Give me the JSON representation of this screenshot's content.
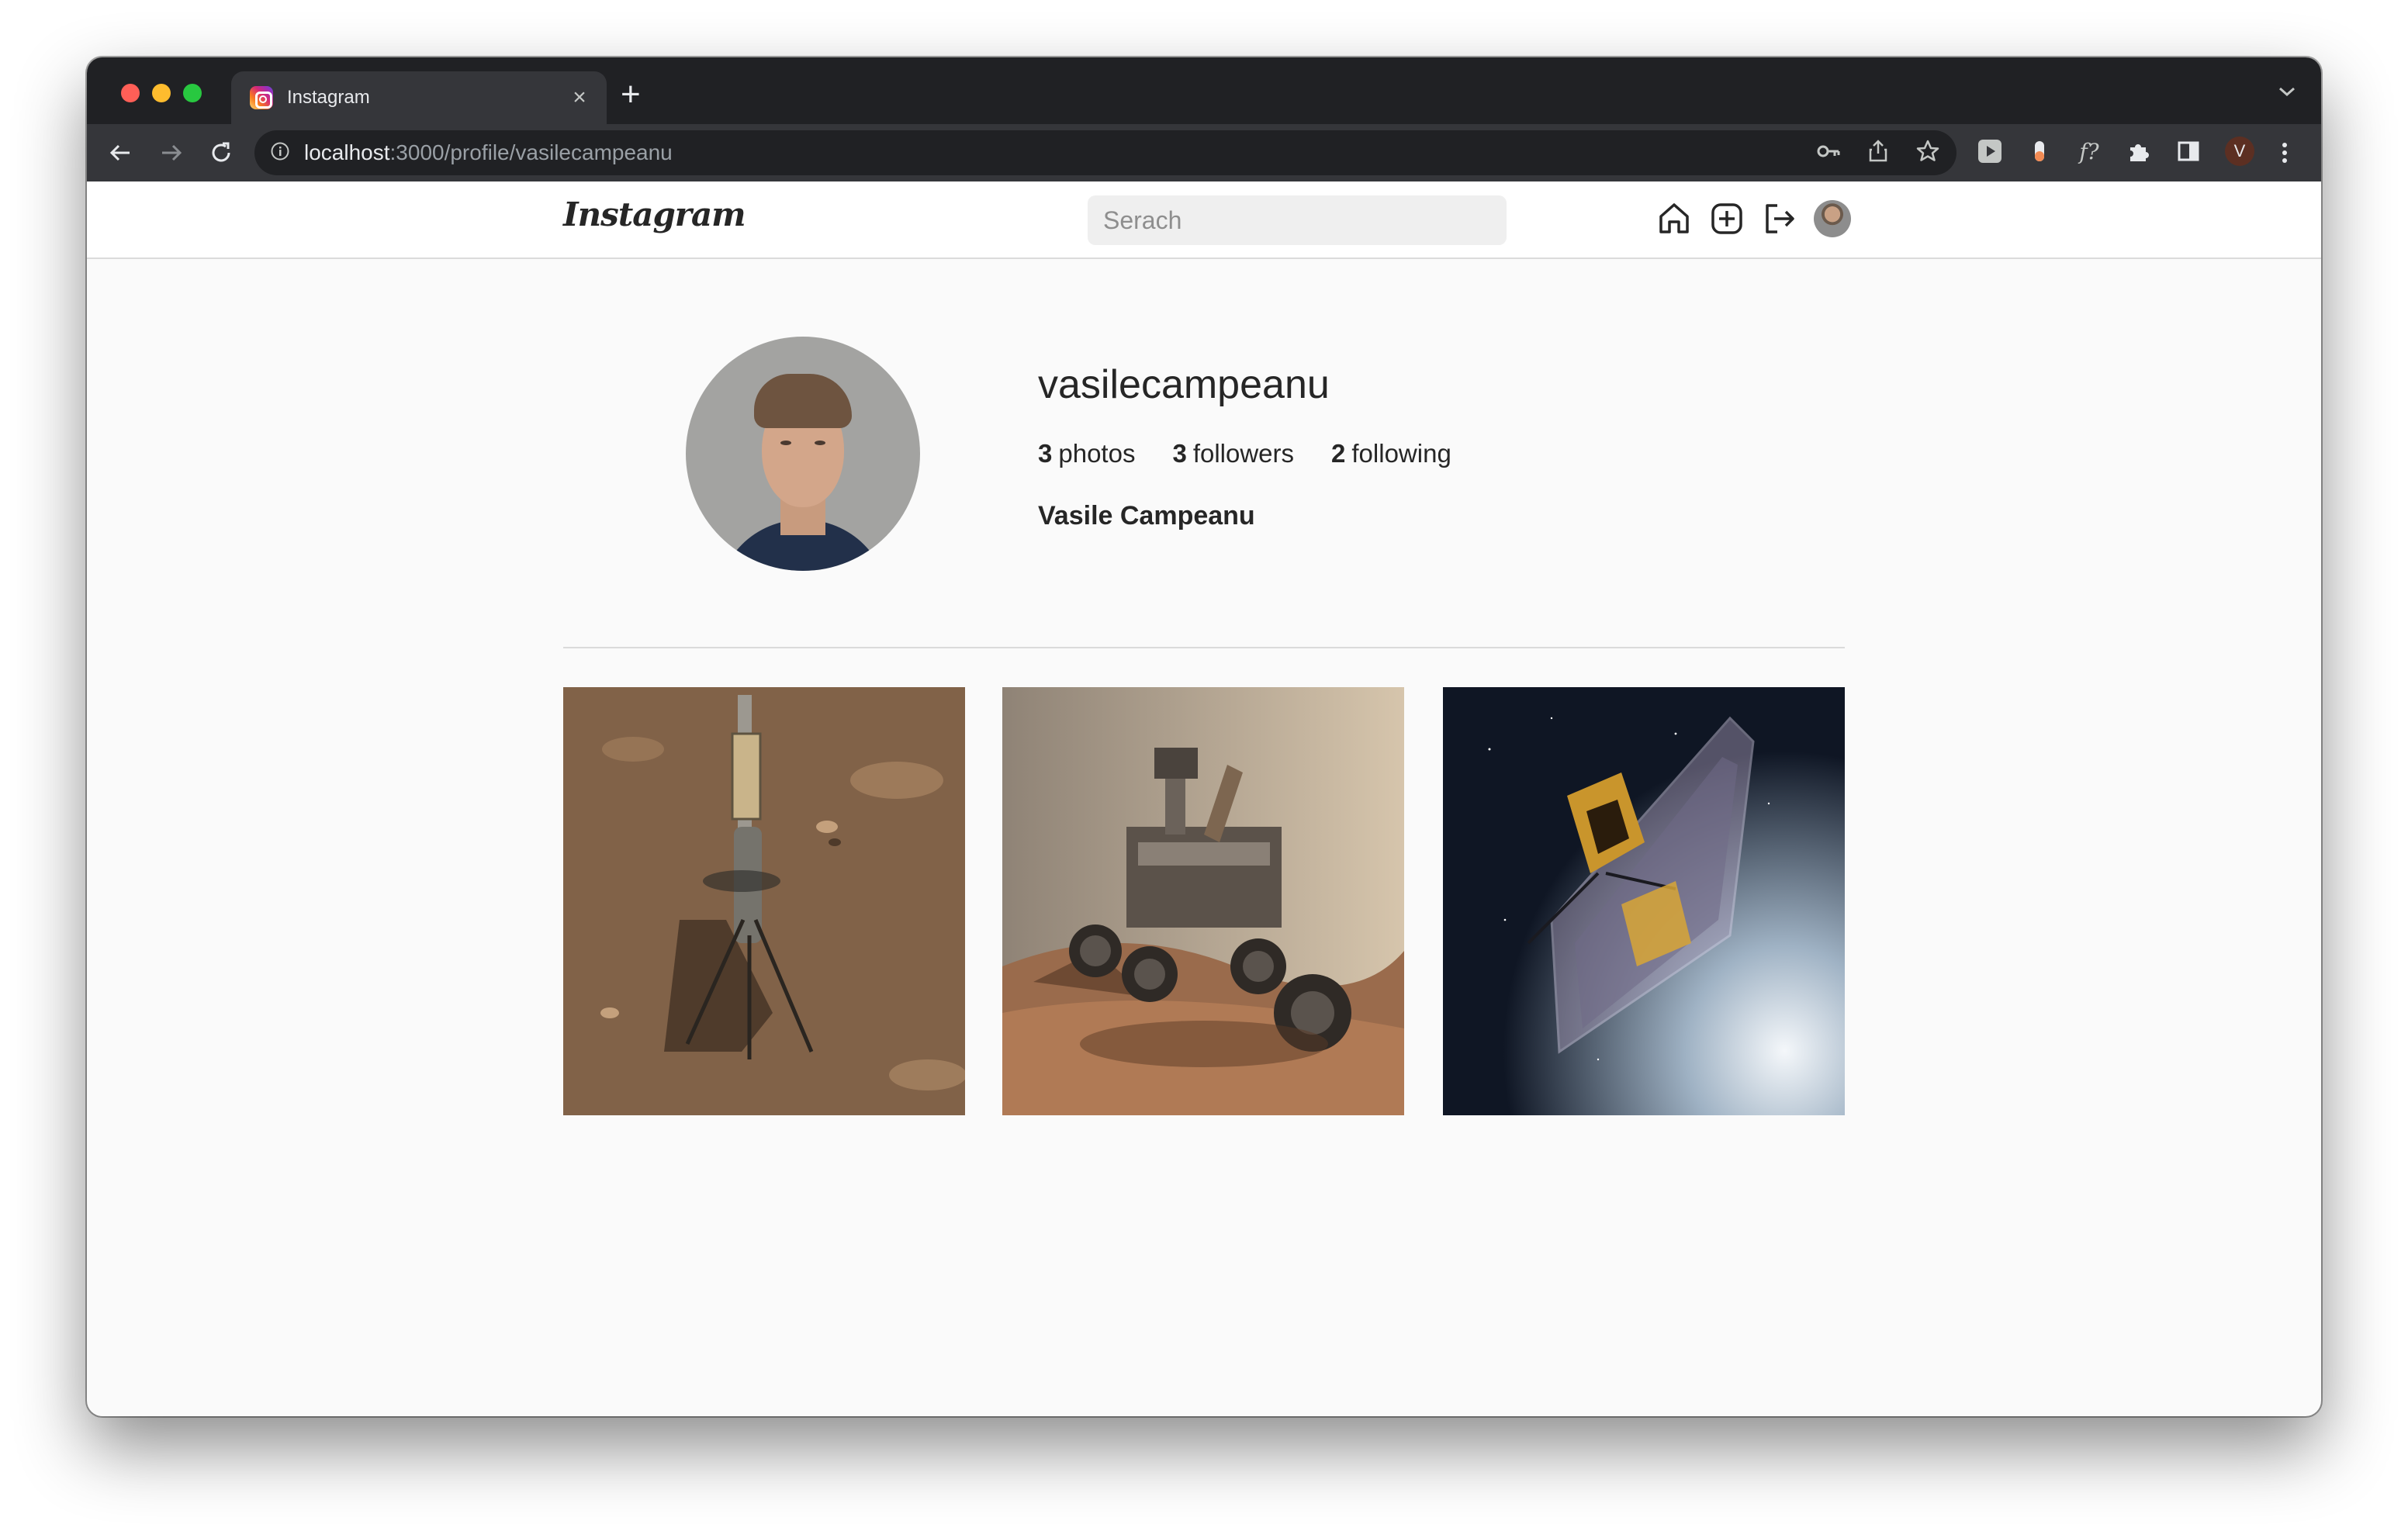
{
  "browser": {
    "tab_title": "Instagram",
    "tab_close": "×",
    "new_tab": "+",
    "url_host": "localhost",
    "url_path": ":3000/profile/vasilecampeanu",
    "profile_initial": "V",
    "ext_f": "f?"
  },
  "header": {
    "logo": "Instagram",
    "search_placeholder": "Serach"
  },
  "profile": {
    "username": "vasilecampeanu",
    "photos_count": "3",
    "photos_label": "photos",
    "followers_count": "3",
    "followers_label": "followers",
    "following_count": "2",
    "following_label": "following",
    "full_name": "Vasile Campeanu"
  },
  "photos": [
    {
      "subject": "helicopter on martian ground"
    },
    {
      "subject": "rover on martian terrain"
    },
    {
      "subject": "space telescope in orbit"
    }
  ],
  "colors": {
    "browser_dark": "#202124",
    "browser_toolbar": "#35363a",
    "page_bg": "#fafafa",
    "text": "#262626",
    "border": "#dbdbdb"
  }
}
